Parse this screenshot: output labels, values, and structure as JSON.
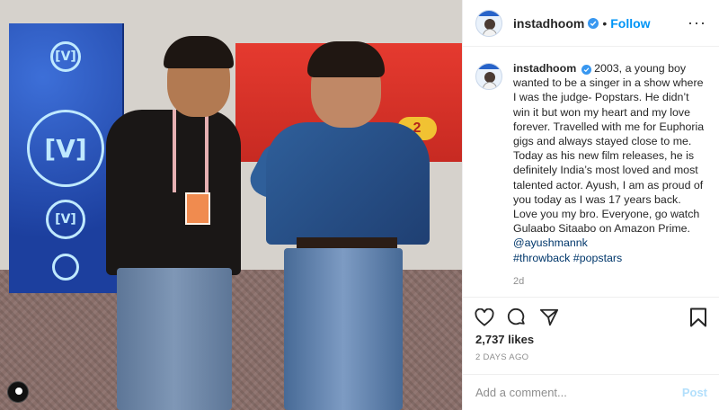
{
  "post": {
    "handle": "instadhoom",
    "follow_label": "Follow",
    "dot": "•",
    "more_label": "···",
    "caption": {
      "handle": "instadhoom",
      "text": " 2003, a young boy wanted to be a singer in a show where I was the judge- Popstars. He didn’t win it but won my heart and my love forever. Travelled with me for Euphoria gigs and always stayed close to me. Today as his new film releases, he is definitely India’s most loved and most talented actor. Ayush, I am as proud of you today as I was 17 years back. Love you my bro. Everyone, go watch Gulaabo Sitaabo on Amazon Prime. ",
      "mention": "@ayushmannk",
      "hashtags": "#throwback #popstars"
    },
    "time_ago": "2d",
    "likes": "2,737 likes",
    "date": "2 DAYS AGO",
    "comment_placeholder": "Add a comment...",
    "post_label": "Post"
  },
  "photo": {
    "channel_logo": "[V]",
    "channel_badge": "2"
  },
  "icons": {
    "verified": "verified-badge-icon",
    "like": "heart-icon",
    "comment": "comment-icon",
    "share": "share-icon",
    "save": "bookmark-icon",
    "more": "more-icon"
  },
  "colors": {
    "accent": "#0095f6",
    "verified": "#3897f0",
    "muted": "#8e8e8e"
  }
}
